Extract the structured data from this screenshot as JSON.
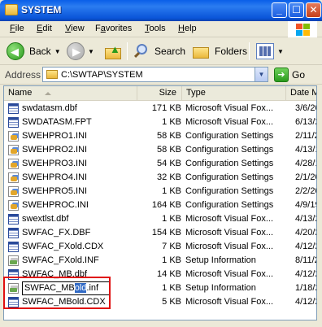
{
  "window": {
    "title": "SYSTEM",
    "min_glyph": "_",
    "max_glyph": "☐",
    "close_glyph": "✕"
  },
  "menu": [
    {
      "label": "File",
      "underline": "F",
      "rest": "ile"
    },
    {
      "label": "Edit",
      "underline": "E",
      "rest": "dit"
    },
    {
      "label": "View",
      "underline": "V",
      "rest": "iew"
    },
    {
      "label": "Favorites",
      "underline": "a",
      "pre": "F",
      "rest": "vorites"
    },
    {
      "label": "Tools",
      "underline": "T",
      "rest": "ools"
    },
    {
      "label": "Help",
      "underline": "H",
      "rest": "elp"
    }
  ],
  "toolbar": {
    "back_label": "Back",
    "search_label": "Search",
    "folders_label": "Folders"
  },
  "address": {
    "label": "Address",
    "path": "C:\\SWTAP\\SYSTEM",
    "go_label": "Go"
  },
  "columns": {
    "name": "Name",
    "size": "Size",
    "type": "Type",
    "date": "Date M"
  },
  "files": [
    {
      "name": "swdatasm.dbf",
      "size": "171 KB",
      "type": "Microsoft Visual Fox...",
      "date": "3/6/20",
      "icon": "table-icon"
    },
    {
      "name": "SWDATASM.FPT",
      "size": "1 KB",
      "type": "Microsoft Visual Fox...",
      "date": "6/13/2",
      "icon": "table-icon"
    },
    {
      "name": "SWEHPRO1.INI",
      "size": "58 KB",
      "type": "Configuration Settings",
      "date": "2/11/2",
      "icon": "settings-icon"
    },
    {
      "name": "SWEHPRO2.INI",
      "size": "58 KB",
      "type": "Configuration Settings",
      "date": "4/13/1",
      "icon": "settings-icon"
    },
    {
      "name": "SWEHPRO3.INI",
      "size": "54 KB",
      "type": "Configuration Settings",
      "date": "4/28/1",
      "icon": "settings-icon"
    },
    {
      "name": "SWEHPRO4.INI",
      "size": "32 KB",
      "type": "Configuration Settings",
      "date": "2/1/20",
      "icon": "settings-icon"
    },
    {
      "name": "SWEHPRO5.INI",
      "size": "1 KB",
      "type": "Configuration Settings",
      "date": "2/2/20",
      "icon": "settings-icon"
    },
    {
      "name": "SWEHPROC.INI",
      "size": "164 KB",
      "type": "Configuration Settings",
      "date": "4/9/19",
      "icon": "settings-icon"
    },
    {
      "name": "swextlst.dbf",
      "size": "1 KB",
      "type": "Microsoft Visual Fox...",
      "date": "4/13/2",
      "icon": "table-icon"
    },
    {
      "name": "SWFAC_FX.DBF",
      "size": "154 KB",
      "type": "Microsoft Visual Fox...",
      "date": "4/20/2",
      "icon": "table-icon"
    },
    {
      "name": "SWFAC_FXold.CDX",
      "size": "7 KB",
      "type": "Microsoft Visual Fox...",
      "date": "4/12/2",
      "icon": "table-icon"
    },
    {
      "name": "SWFAC_FXold.INF",
      "size": "1 KB",
      "type": "Setup Information",
      "date": "8/11/2",
      "icon": "setup-icon"
    },
    {
      "name": "SWFAC_MB.dbf",
      "size": "14 KB",
      "type": "Microsoft Visual Fox...",
      "date": "4/12/2",
      "icon": "table-icon"
    },
    {
      "name": "SWFAC_MBold.inf",
      "size": "1 KB",
      "type": "Setup Information",
      "date": "1/18/2",
      "icon": "setup-icon",
      "renaming": true,
      "rename_prefix": "SWFAC_MB",
      "rename_selected": "old",
      "rename_suffix": ".inf"
    },
    {
      "name": "SWFAC_MBold.CDX",
      "size": "5 KB",
      "type": "Microsoft Visual Fox...",
      "date": "4/12/2",
      "icon": "table-icon"
    }
  ]
}
